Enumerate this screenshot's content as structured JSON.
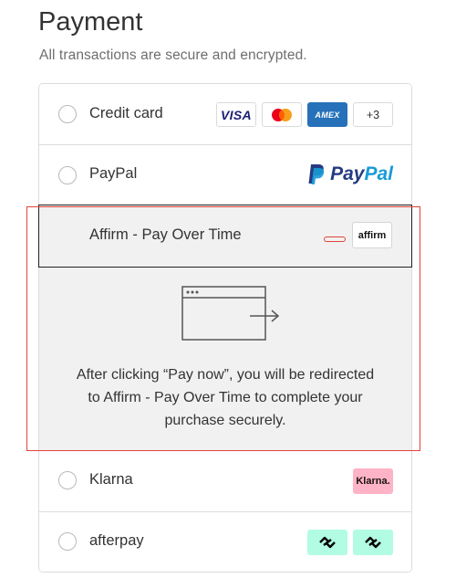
{
  "header": {
    "title": "Payment",
    "subtitle": "All transactions are secure and encrypted."
  },
  "methods": [
    {
      "label": "Credit card",
      "selected": false,
      "logos": [
        "VISA",
        "mastercard",
        "AMEX",
        "+3"
      ]
    },
    {
      "label": "PayPal",
      "selected": false,
      "logo_text_1": "Pay",
      "logo_text_2": "Pal"
    },
    {
      "label": "Affirm - Pay Over Time",
      "selected": true,
      "logo_text": "affirm",
      "redirect_message": "After clicking “Pay now”, you will be redirected to Affirm - Pay Over Time to complete your purchase securely."
    },
    {
      "label": "Klarna",
      "selected": false,
      "logo_text": "Klarna."
    },
    {
      "label": "afterpay",
      "selected": false,
      "logos": [
        "afterpay-icon",
        "afterpay-icon"
      ]
    }
  ],
  "colors": {
    "highlight": "#e0453a",
    "amex": "#2671b9",
    "klarna": "#ffb3c7",
    "afterpay": "#b2fce4",
    "paypal_dark": "#253b80",
    "paypal_light": "#179bd7"
  }
}
